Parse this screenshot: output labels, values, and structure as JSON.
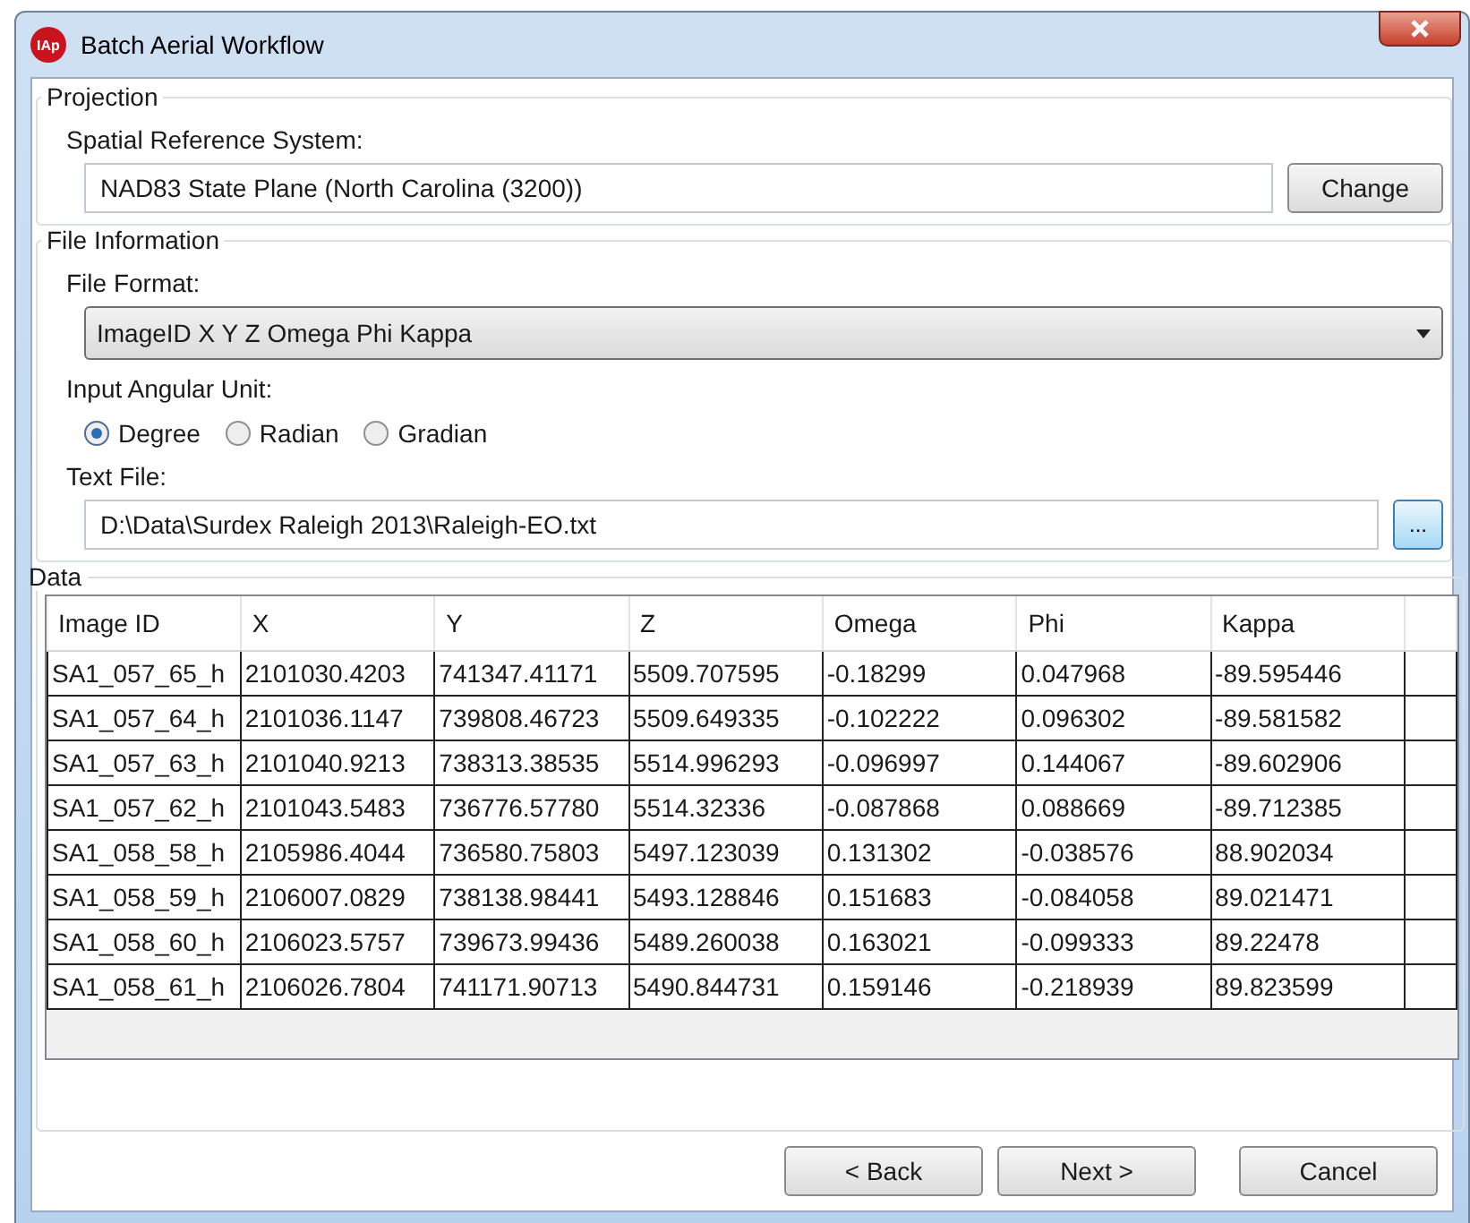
{
  "window": {
    "title": "Batch Aerial Workflow",
    "app_badge": "IAp"
  },
  "projection": {
    "legend": "Projection",
    "srs_label": "Spatial Reference System:",
    "srs_value": "NAD83 State Plane (North Carolina (3200))",
    "change_button": "Change"
  },
  "file_information": {
    "legend": "File Information",
    "format_label": "File Format:",
    "format_value": "ImageID X Y Z Omega Phi Kappa",
    "angular_label": "Input Angular Unit:",
    "angular_units": [
      {
        "label": "Degree",
        "selected": true
      },
      {
        "label": "Radian",
        "selected": false
      },
      {
        "label": "Gradian",
        "selected": false
      }
    ],
    "text_file_label": "Text File:",
    "text_file_value": "D:\\Data\\Surdex Raleigh 2013\\Raleigh-EO.txt",
    "browse_button": "..."
  },
  "data": {
    "legend": "Data",
    "table": {
      "columns": [
        "Image ID",
        "X",
        "Y",
        "Z",
        "Omega",
        "Phi",
        "Kappa"
      ],
      "rows": [
        [
          "SA1_057_65_h",
          "2101030.4203",
          "741347.41171",
          "5509.707595",
          "-0.18299",
          "0.047968",
          "-89.595446"
        ],
        [
          "SA1_057_64_h",
          "2101036.1147",
          "739808.46723",
          "5509.649335",
          "-0.102222",
          "0.096302",
          "-89.581582"
        ],
        [
          "SA1_057_63_h",
          "2101040.9213",
          "738313.38535",
          "5514.996293",
          "-0.096997",
          "0.144067",
          "-89.602906"
        ],
        [
          "SA1_057_62_h",
          "2101043.5483",
          "736776.57780",
          "5514.32336",
          "-0.087868",
          "0.088669",
          "-89.712385"
        ],
        [
          "SA1_058_58_h",
          "2105986.4044",
          "736580.75803",
          "5497.123039",
          "0.131302",
          "-0.038576",
          "88.902034"
        ],
        [
          "SA1_058_59_h",
          "2106007.0829",
          "738138.98441",
          "5493.128846",
          "0.151683",
          "-0.084058",
          "89.021471"
        ],
        [
          "SA1_058_60_h",
          "2106023.5757",
          "739673.99436",
          "5489.260038",
          "0.163021",
          "-0.099333",
          "89.22478"
        ],
        [
          "SA1_058_61_h",
          "2106026.7804",
          "741171.90713",
          "5490.844731",
          "0.159146",
          "-0.218939",
          "89.823599"
        ]
      ]
    }
  },
  "buttons": [
    {
      "label": "< Back"
    },
    {
      "label": "Next >"
    },
    {
      "label": "Cancel"
    }
  ]
}
